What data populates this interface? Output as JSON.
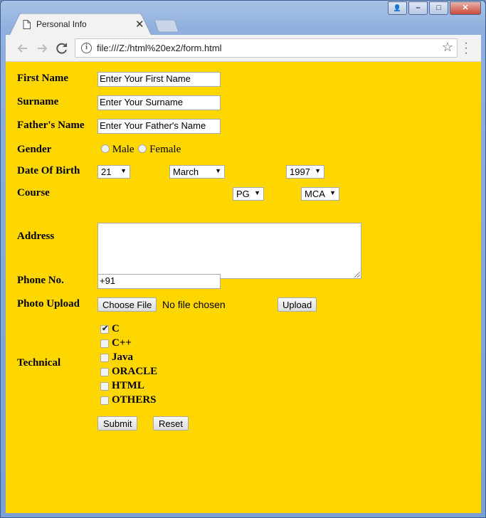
{
  "browser": {
    "tab_title": "Personal Info",
    "tab_close": "✕",
    "url": "file:///Z:/html%20ex2/form.html",
    "window_buttons": {
      "user": "👤",
      "minimize": "–",
      "maximize": "□",
      "close": "✕"
    },
    "icons": {
      "back": "arrow-left-icon",
      "forward": "arrow-right-icon",
      "reload": "reload-icon",
      "info": "info-icon",
      "bookmark": "star-icon",
      "menu": "kebab-menu-icon"
    }
  },
  "form": {
    "background": "#ffd700",
    "first_name": {
      "label": "First Name",
      "value": "Enter Your First Name"
    },
    "surname": {
      "label": "Surname",
      "value": "Enter Your Surname"
    },
    "fathers_name": {
      "label": "Father's Name",
      "value": "Enter Your Father's Name"
    },
    "gender": {
      "label": "Gender",
      "options": [
        "Male",
        "Female"
      ]
    },
    "dob": {
      "label": "Date Of Birth",
      "day": "21",
      "month": "March",
      "year": "1997"
    },
    "course": {
      "label": "Course",
      "level": "PG",
      "program": "MCA"
    },
    "address": {
      "label": "Address",
      "value": ""
    },
    "phone": {
      "label": "Phone No.",
      "value": "+91"
    },
    "photo": {
      "label": "Photo Upload",
      "choose_label": "Choose File",
      "status": "No file chosen",
      "upload_label": "Upload"
    },
    "technical": {
      "label": "Technical",
      "items": [
        {
          "label": "C",
          "checked": true
        },
        {
          "label": "C++",
          "checked": false
        },
        {
          "label": "Java",
          "checked": false
        },
        {
          "label": "ORACLE",
          "checked": false
        },
        {
          "label": "HTML",
          "checked": false
        },
        {
          "label": "OTHERS",
          "checked": false
        }
      ]
    },
    "submit_label": "Submit",
    "reset_label": "Reset"
  }
}
